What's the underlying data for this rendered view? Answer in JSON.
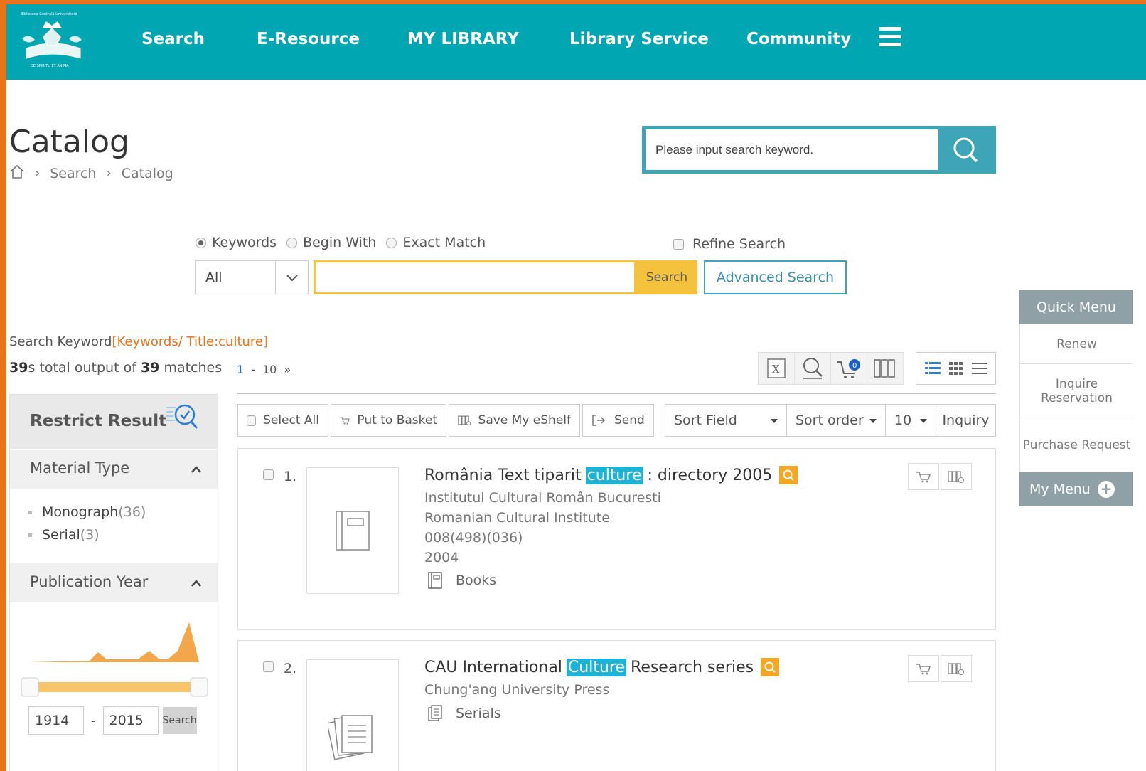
{
  "header": {
    "logo_alt": "Biblioteca Centrală Universitară Carol I",
    "nav": [
      {
        "label": "Search"
      },
      {
        "label": "E-Resource"
      },
      {
        "label": "MY LIBRARY"
      },
      {
        "label": "Library Service"
      },
      {
        "label": "Community"
      }
    ],
    "menu_icon": "hamburger-icon"
  },
  "page": {
    "title": "Catalog",
    "breadcrumb": [
      "Search",
      "Catalog"
    ],
    "top_search_placeholder": "Please input search keyword."
  },
  "search_form": {
    "modes": [
      {
        "label": "Keywords",
        "selected": true
      },
      {
        "label": "Begin With",
        "selected": false
      },
      {
        "label": "Exact Match",
        "selected": false
      }
    ],
    "refine_label": "Refine Search",
    "scope_value": "All",
    "query_value": "",
    "search_button": "Search",
    "advanced_button": "Advanced Search"
  },
  "results_meta": {
    "keyword_prefix": "Search Keyword",
    "keyword_value": "[Keywords/ Title:culture]",
    "total_count": "39",
    "total_suffix_1": "s total output of",
    "match_count": "39",
    "total_suffix_2": "matches",
    "pager_current": "1",
    "pager_sep": "-",
    "pager_end": "10",
    "pager_next": "»",
    "basket_count": "0"
  },
  "facets": {
    "title": "Restrict Result",
    "material_type": {
      "title": "Material Type",
      "items": [
        {
          "label": "Monograph",
          "count": "(36)"
        },
        {
          "label": "Serial",
          "count": "(3)"
        }
      ]
    },
    "publication_year": {
      "title": "Publication Year",
      "from": "1914",
      "to": "2015",
      "button": "Search"
    }
  },
  "action_bar": {
    "select_all": "Select All",
    "put_to_basket": "Put to Basket",
    "save_eshelf": "Save My eShelf",
    "send": "Send",
    "sort_field": "Sort Field",
    "sort_order": "Sort order",
    "page_size": "10",
    "inquiry": "Inquiry"
  },
  "results": [
    {
      "num": "1.",
      "title_before": "România Text tiparit",
      "title_match": "culture",
      "title_after": ": directory 2005",
      "lines": [
        "Institutul Cultural Român Bucuresti",
        "Romanian Cultural Institute",
        "008(498)(036)",
        "2004"
      ],
      "type": "Books"
    },
    {
      "num": "2.",
      "title_before": "CAU International",
      "title_match": "Culture",
      "title_after": "Research series",
      "lines": [
        "Chung'ang University Press"
      ],
      "type": "Serials"
    }
  ],
  "quick_menu": {
    "title": "Quick Menu",
    "items": [
      "Renew",
      "Inquire Reservation",
      "Purchase Request"
    ],
    "my_menu": "My Menu",
    "plus": "+"
  },
  "colors": {
    "header_bg": "#00a6b2",
    "accent_orange": "#e8731a",
    "search_yellow": "#f5c23e",
    "teal_button": "#3ea4b8",
    "match_highlight": "#1bb3d6"
  }
}
